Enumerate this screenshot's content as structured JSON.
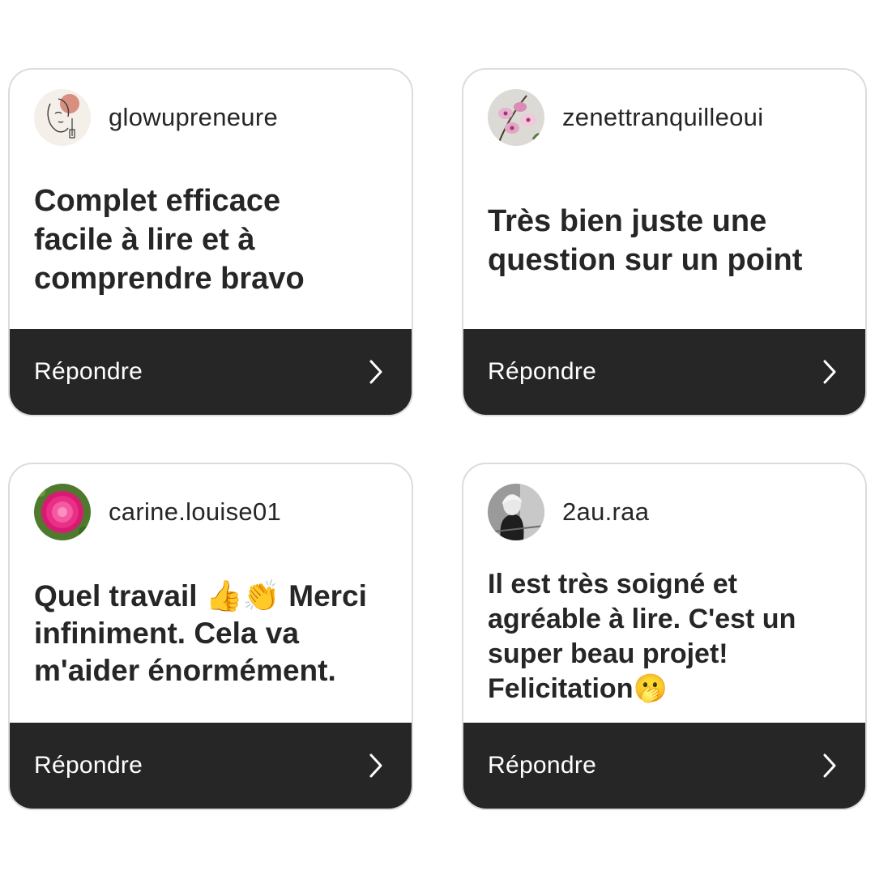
{
  "reply_label": "Répondre",
  "colors": {
    "reply_bar": "#262626",
    "card_border": "#dcdcdc",
    "text": "#262626"
  },
  "cards": [
    {
      "username": "glowupreneure",
      "avatar": "line-art-face-avatar",
      "comment_lines": [
        "Complet efficace",
        "facile à lire et à",
        "comprendre bravo"
      ]
    },
    {
      "username": "zenettranquilleoui",
      "avatar": "orchid-photo-avatar",
      "comment_lines": [
        "Très bien juste une",
        "question sur un point"
      ]
    },
    {
      "username": "carine.louise01",
      "avatar": "pink-flower-photo-avatar",
      "comment_parts": {
        "text1": "Quel travail ",
        "emoji1": "👍",
        "emoji2": "👏",
        "text2": " Merci"
      },
      "comment_lines": [
        "infiniment. Cela va",
        "m'aider énormément."
      ]
    },
    {
      "username": "2au.raa",
      "avatar": "bw-portrait-avatar",
      "comment_lines": [
        "Il est très soigné et",
        "agréable à lire. C'est un",
        "super beau projet!"
      ],
      "last_line": {
        "text": "Felicitation",
        "emoji": "🫢"
      }
    }
  ]
}
